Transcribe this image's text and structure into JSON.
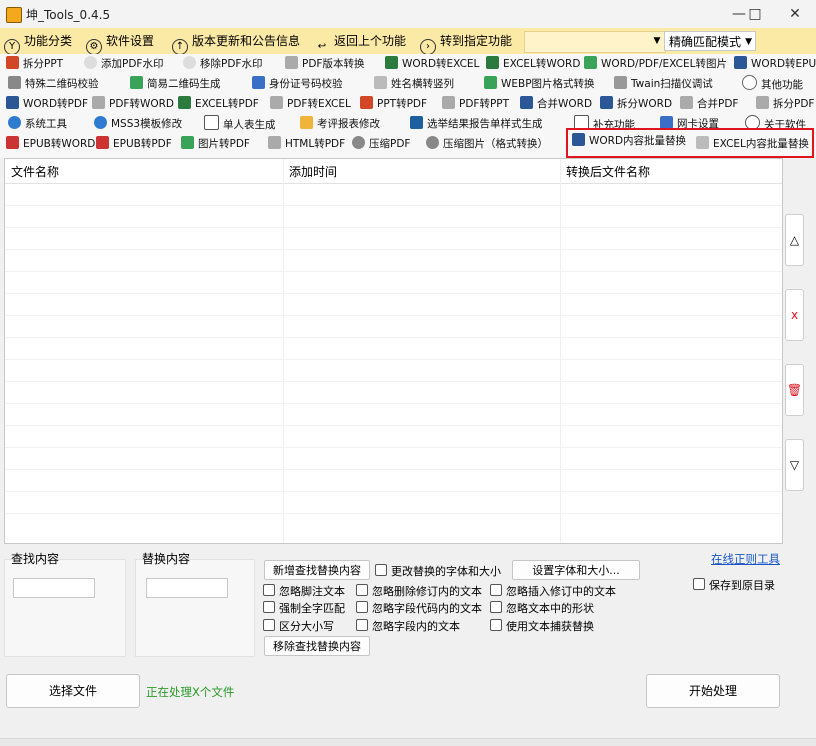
{
  "window": {
    "title": "坤_Tools_0.4.5",
    "minimize": "—",
    "maximize": "□",
    "close": "✕"
  },
  "menu": {
    "items": [
      {
        "label": "功能分类",
        "icon": "filter-icon"
      },
      {
        "label": "软件设置",
        "icon": "gear-icon"
      },
      {
        "label": "版本更新和公告信息",
        "icon": "up-arrow-icon"
      },
      {
        "label": "返回上个功能",
        "icon": "back-arrow-icon"
      },
      {
        "label": "转到指定功能",
        "icon": "forward-icon"
      }
    ],
    "match_mode": "精确匹配模式"
  },
  "toolbar": {
    "rows": [
      [
        "拆分PPT",
        "添加PDF水印",
        "移除PDF水印",
        "PDF版本转换",
        "WORD转EXCEL",
        "EXCEL转WORD",
        "WORD/PDF/EXCEL转图片",
        "WORD转EPUB"
      ],
      [
        "特殊二维码校验",
        "简易二维码生成",
        "身份证号码校验",
        "姓名横转竖列",
        "WEBP图片格式转换",
        "Twain扫描仪调试",
        "其他功能"
      ],
      [
        "WORD转PDF",
        "PDF转WORD",
        "EXCEL转PDF",
        "PDF转EXCEL",
        "PPT转PDF",
        "PDF转PPT",
        "合并WORD",
        "拆分WORD",
        "合并PDF",
        "拆分PDF"
      ],
      [
        "系统工具",
        "MSS3模板修改",
        "单人表生成",
        "考评报表修改",
        "选举结果报告单样式生成",
        "补充功能",
        "网卡设置",
        "关于软件"
      ],
      [
        "EPUB转WORD",
        "EPUB转PDF",
        "图片转PDF",
        "HTML转PDF",
        "压缩PDF",
        "压缩图片（格式转换）",
        "WORD内容批量替换",
        "EXCEL内容批量替换"
      ]
    ]
  },
  "table": {
    "headers": [
      "文件名称",
      "添加时间",
      "转换后文件名称"
    ]
  },
  "side_buttons": {
    "up": "△",
    "remove": "x",
    "clear": "🗑",
    "down": "▽"
  },
  "find": {
    "label": "查找内容",
    "value": ""
  },
  "replace": {
    "label": "替换内容",
    "value": ""
  },
  "buttons": {
    "add_pair": "新增查找替换内容",
    "font_setting": "设置字体和大小...",
    "remove_pair": "移除查找替换内容",
    "select_file": "选择文件",
    "start": "开始处理"
  },
  "options": {
    "change_font": "更改替换的字体和大小",
    "ignore_footnote": "忽略脚注文本",
    "ignore_deleted": "忽略删除修订内的文本",
    "ignore_inserted": "忽略插入修订中的文本",
    "whole_word": "强制全字匹配",
    "ignore_field_code": "忽略字段代码内的文本",
    "ignore_shapes": "忽略文本中的形状",
    "match_case": "区分大小写",
    "ignore_field": "忽略字段内的文本",
    "use_capture": "使用文本捕获替换",
    "save_to_source": "保存到原目录"
  },
  "regex_link": "在线正则工具",
  "status": "正在处理X个文件"
}
